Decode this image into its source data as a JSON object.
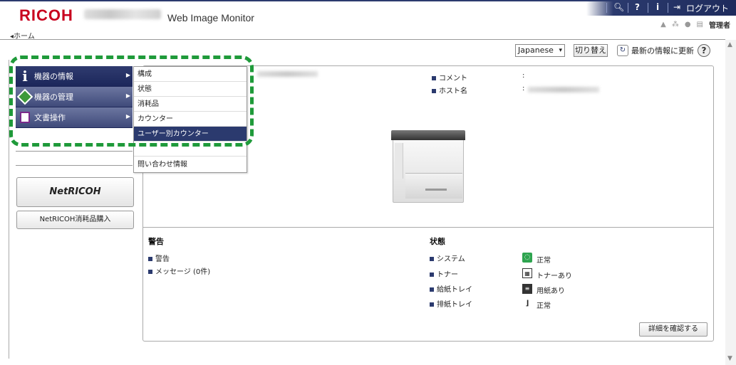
{
  "header": {
    "logo": "RICOH",
    "app_title": "Web Image Monitor",
    "logout_label": "ログアウト",
    "admin_label": "管理者",
    "breadcrumb_home": "◂ホーム"
  },
  "toolbar": {
    "language": "Japanese",
    "switch_label": "切り替え",
    "refresh_label": "最新の情報に更新",
    "help_label": "?"
  },
  "sidebar": {
    "items": [
      {
        "label": "機器の情報",
        "icon": "info-icon"
      },
      {
        "label": "機器の管理",
        "icon": "device-manage-icon"
      },
      {
        "label": "文書操作",
        "icon": "document-icon"
      }
    ],
    "netricoh_label": "NetRICOH",
    "netricoh_buy_label": "NetRICOH消耗品購入"
  },
  "submenu": {
    "items": [
      {
        "label": "構成"
      },
      {
        "label": "状態"
      },
      {
        "label": "消耗品"
      },
      {
        "label": "カウンター"
      },
      {
        "label": "ユーザー別カウンター"
      },
      {
        "label": ""
      },
      {
        "label": "問い合わせ情報"
      }
    ],
    "active_index": 4
  },
  "device": {
    "comment_label": "コメント",
    "comment_value": ":",
    "host_label": "ホスト名",
    "host_value": ":"
  },
  "alerts": {
    "title": "警告",
    "items": [
      "警告",
      "メッセージ (0件)"
    ]
  },
  "status": {
    "title": "状態",
    "rows": [
      {
        "label": "システム",
        "value": "正常",
        "icon": "ok-icon"
      },
      {
        "label": "トナー",
        "value": "トナーあり",
        "icon": "toner-icon"
      },
      {
        "label": "給紙トレイ",
        "value": "用紙あり",
        "icon": "paper-tray-icon"
      },
      {
        "label": "排紙トレイ",
        "value": "正常",
        "icon": "output-tray-icon"
      }
    ],
    "details_button": "詳細を確認する"
  },
  "colors": {
    "brand_red": "#c8001e",
    "nav_blue": "#2b3a6e",
    "highlight_green": "#1f9a3a"
  }
}
